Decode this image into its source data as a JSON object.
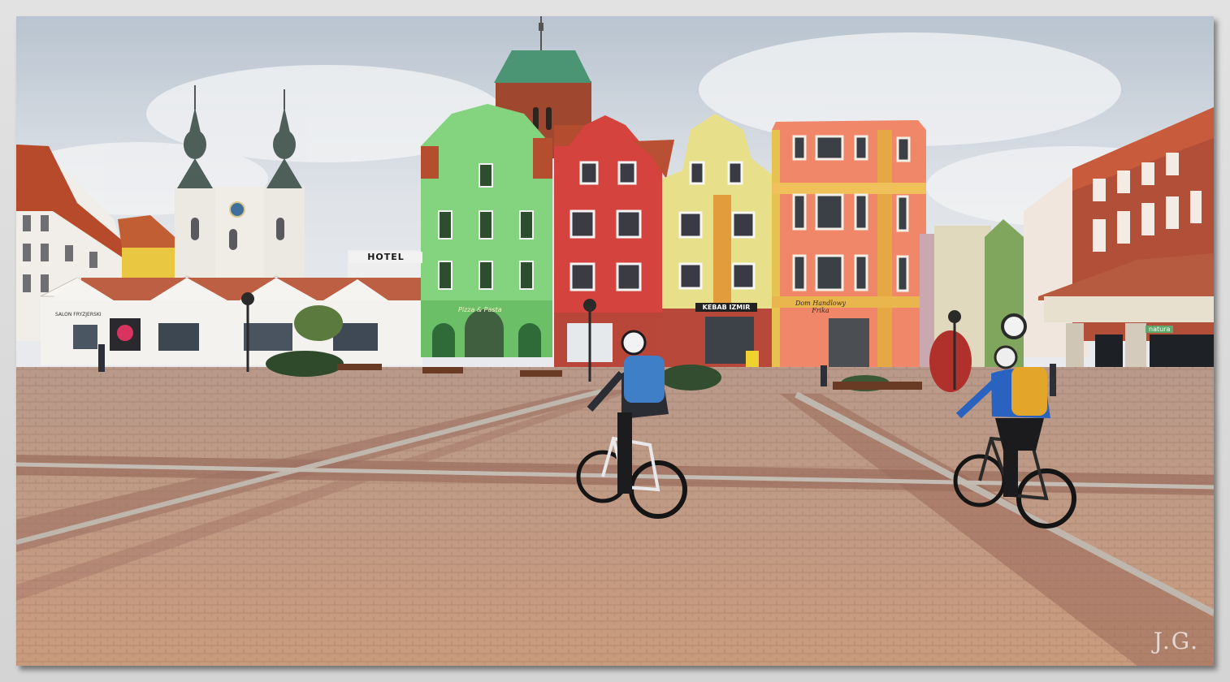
{
  "scene": {
    "description_hidden": "",
    "signs": {
      "hotel": "HOTEL",
      "kebab": "KEBAB IZMIR",
      "dom_handlowy_line1": "Dom Handlowy",
      "dom_handlowy_line2": "Frika",
      "pizza": "Pizza & Pasta",
      "salon": "SALON FRYZJERSKI",
      "natura": "natura"
    },
    "watermark": "J.G."
  },
  "colors": {
    "sky": "#cfd6df",
    "pavement": "#c59a83",
    "green_house": "#7dd67c",
    "red_house": "#d63e3a",
    "yellow_house": "#e6dc86",
    "orange_house": "#e8853f",
    "roof_tile": "#b4502e"
  }
}
